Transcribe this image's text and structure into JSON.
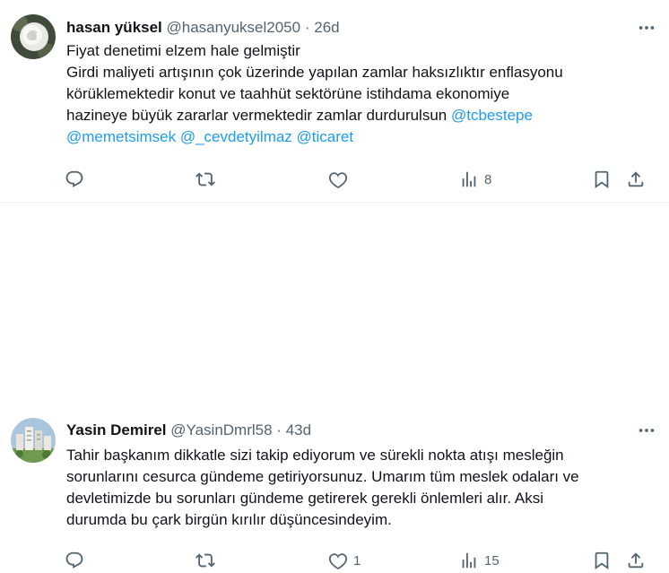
{
  "tweets": [
    {
      "name": "hasan yüksel",
      "handle": "@hasanyuksel2050",
      "separator": "·",
      "time": "26d",
      "lines": [
        [
          {
            "t": "Fiyat denetimi elzem hale gelmiştir"
          }
        ],
        [
          {
            "t": "Girdi maliyeti artışının çok üzerinde yapılan zamlar haksızlıktır enflasyonu"
          }
        ],
        [
          {
            "t": "körüklemektedir konut ve taahhüt sektörüne istihdama ekonomiye"
          }
        ],
        [
          {
            "t": "hazineye büyük zararlar vermektedir zamlar durdurulsun "
          },
          {
            "t": "@tcbestepe",
            "m": true
          }
        ],
        [
          {
            "t": "@memetsimsek",
            "m": true
          },
          {
            "t": " "
          },
          {
            "t": "@_cevdetyilmaz",
            "m": true
          },
          {
            "t": " "
          },
          {
            "t": "@ticaret",
            "m": true
          }
        ]
      ],
      "reply_count": "",
      "retweet_count": "",
      "like_count": "",
      "views_count": "8"
    },
    {
      "name": "Yasin Demirel",
      "handle": "@YasinDmrl58",
      "separator": "·",
      "time": "43d",
      "lines": [
        [
          {
            "t": "Tahir başkanım dikkatle sizi takip ediyorum ve sürekli nokta atışı mesleğin"
          }
        ],
        [
          {
            "t": "sorunlarını cesurca gündeme getiriyorsunuz. Umarım tüm meslek odaları ve"
          }
        ],
        [
          {
            "t": "devletimizde bu sorunları gündeme getirerek gerekli önlemleri alır. Aksi"
          }
        ],
        [
          {
            "t": "durumda bu çark birgün kırılır düşüncesindeyim."
          }
        ]
      ],
      "reply_count": "",
      "retweet_count": "",
      "like_count": "1",
      "views_count": "15"
    }
  ],
  "icons": {
    "avatar_1": "white-rose-avatar",
    "avatar_2": "building-complex-avatar",
    "more": "more-dots-icon",
    "reply": "reply-icon",
    "retweet": "retweet-icon",
    "like": "heart-icon",
    "views": "views-chart-icon",
    "bookmark": "bookmark-icon",
    "share": "share-icon"
  },
  "colors": {
    "text": "#0f1419",
    "secondary": "#536471",
    "mention": "#1d9bf0",
    "divider": "#eff3f4"
  }
}
